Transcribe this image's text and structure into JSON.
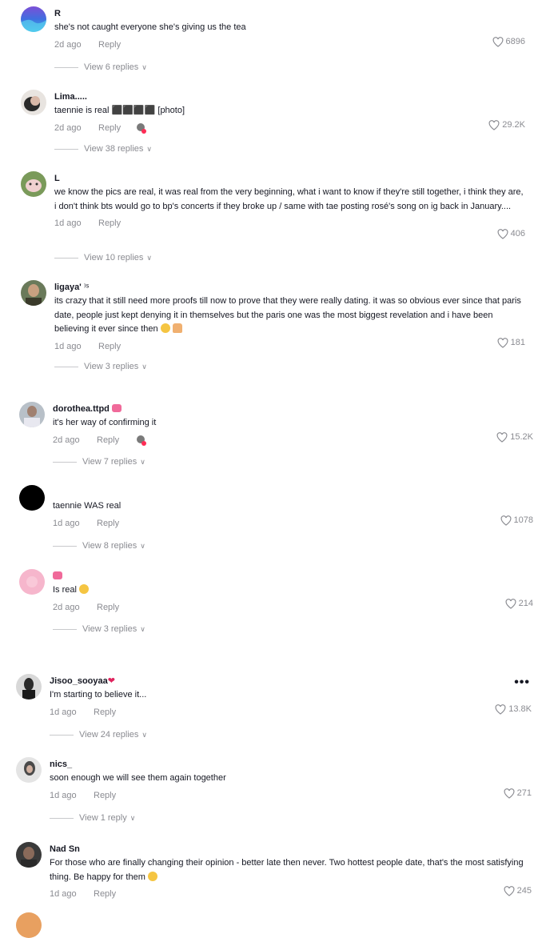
{
  "comments": [
    {
      "username": "R",
      "badge": "",
      "text": "she's not caught everyone she's giving us the tea",
      "date": "2d ago",
      "reply": "Reply",
      "likes": "6896",
      "replies": "View 6 replies"
    },
    {
      "username": "Lima.....",
      "badge": "",
      "text": "taennie is real ⬛⬛⬛⬛ [photo]",
      "date": "2d ago",
      "reply": "Reply",
      "likes": "29.2K",
      "replies": "View 38 replies"
    },
    {
      "username": "L",
      "badge": "",
      "text": "we know the pics are real, it was real from the very beginning, what i want to know if they're still together, i think they are, i don't think bts would go to bp's concerts if they broke up / same with tae posting rosé's song on ig back in January....",
      "date": "1d ago",
      "reply": "Reply",
      "likes": "406",
      "replies": "View 10 replies"
    },
    {
      "username": "ligaya'",
      "badge": "⁾ˢ",
      "text": "its crazy that it still need more proofs till now to prove that they were really dating. it was so obvious ever since that paris date, people just kept denying it in themselves but the paris one was the most biggest revelation and i have been believing it ever since then",
      "date": "1d ago",
      "reply": "Reply",
      "likes": "181",
      "replies": "View 3 replies"
    },
    {
      "username": "dorothea.ttpd",
      "badge": "",
      "text": "it's her way of confirming it",
      "date": "2d ago",
      "reply": "Reply",
      "likes": "15.2K",
      "replies": "View 7 replies"
    },
    {
      "username": "",
      "badge": "",
      "text": "taennie WAS real",
      "date": "1d ago",
      "reply": "Reply",
      "likes": "1078",
      "replies": "View 8 replies"
    },
    {
      "username": "",
      "badge": "",
      "text": "Is real",
      "date": "2d ago",
      "reply": "Reply",
      "likes": "214",
      "replies": "View 3 replies"
    },
    {
      "username": "Jisoo_sooyaa",
      "badge": "",
      "text": "I'm starting to believe it...",
      "date": "1d ago",
      "reply": "Reply",
      "likes": "13.8K",
      "replies": "View 24 replies"
    },
    {
      "username": "nics_",
      "badge": "",
      "text": "soon enough we will see them again together",
      "date": "1d ago",
      "reply": "Reply",
      "likes": "271",
      "replies": "View 1 reply"
    },
    {
      "username": "Nad Sn",
      "badge": "",
      "text": "For those who are finally changing their opinion - better late then never. Two hottest people date, that's the most satisfying thing. Be happy for them",
      "date": "1d ago",
      "reply": "Reply",
      "likes": "245",
      "replies": ""
    }
  ],
  "icons": {
    "like": "heart-outline-icon",
    "more": "more-options-icon",
    "expand": "chevron-down-icon"
  },
  "more_label": "•••",
  "chevron": "∨",
  "colors": {
    "text": "#161823",
    "muted": "#8a8b91"
  }
}
